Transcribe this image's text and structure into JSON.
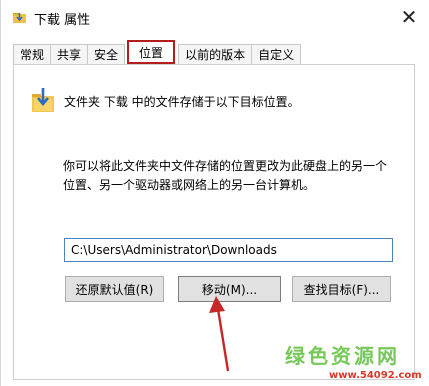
{
  "window": {
    "title": "下载 属性",
    "close_symbol": "✕",
    "title_icon": "download-folder-icon"
  },
  "tabs": [
    {
      "label": "常规",
      "active": false
    },
    {
      "label": "共享",
      "active": false
    },
    {
      "label": "安全",
      "active": false
    },
    {
      "label": "位置",
      "active": true
    },
    {
      "label": "以前的版本",
      "active": false
    },
    {
      "label": "自定义",
      "active": false
    }
  ],
  "location": {
    "icon": "download-folder-icon",
    "description": "文件夹 下载 中的文件存储于以下目标位置。",
    "explanation_line1": "你可以将此文件夹中文件存储的位置更改为此硬盘上的另一个",
    "explanation_line2": "位置、另一个驱动器或网络上的另一台计算机。",
    "path_value": "C:\\Users\\Administrator\\Downloads"
  },
  "buttons": {
    "restore_default": "还原默认值(R)",
    "move": "移动(M)...",
    "find_target": "查找目标(F)..."
  },
  "annotation": {
    "highlight_color": "#b71c1c",
    "arrow_color": "#c62828"
  },
  "watermark": {
    "title": "绿色资源网",
    "url": "www.54092.com"
  }
}
